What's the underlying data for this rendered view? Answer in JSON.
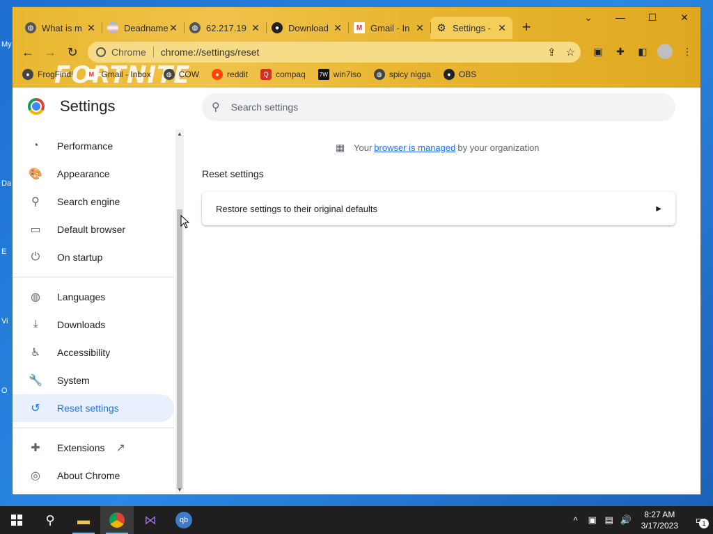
{
  "desktop": {
    "icon_labels": [
      "My",
      "Da",
      "E",
      "Vi",
      "O"
    ]
  },
  "tabs": [
    {
      "label": "What is m",
      "favicon": "globe-icon",
      "color": "#555555"
    },
    {
      "label": "Deadname",
      "favicon": "flag-icon",
      "color": "#c9a0dc"
    },
    {
      "label": "62.217.19",
      "favicon": "globe-icon",
      "color": "#555555"
    },
    {
      "label": "Download",
      "favicon": "obs-icon",
      "color": "#222222"
    },
    {
      "label": "Gmail - In",
      "favicon": "gmail-icon",
      "color": "#d93025"
    },
    {
      "label": "Settings -",
      "favicon": "gear-icon",
      "color": "#202124",
      "active": true
    }
  ],
  "omnibox": {
    "chip": "Chrome",
    "url": "chrome://settings/reset"
  },
  "bookmarks": [
    {
      "label": "FrogFind!",
      "color": "#444444"
    },
    {
      "label": "Gmail - Inbox",
      "color": "#d93025"
    },
    {
      "label": "COW",
      "color": "#444444"
    },
    {
      "label": "reddit",
      "color": "#ff4500"
    },
    {
      "label": "compaq",
      "color": "#d93025"
    },
    {
      "label": "win7iso",
      "color": "#111111"
    },
    {
      "label": "spicy nigga",
      "color": "#444444"
    },
    {
      "label": "OBS",
      "color": "#222222"
    }
  ],
  "background_text": "FORTNITE",
  "settings": {
    "title": "Settings",
    "search_placeholder": "Search settings",
    "managed_prefix": "Your",
    "managed_link": "browser is managed",
    "managed_suffix": "by your organization",
    "section_title": "Reset settings",
    "card_label": "Restore settings to their original defaults"
  },
  "nav": {
    "group1": [
      {
        "label": "Performance",
        "icon": "speedometer-icon"
      },
      {
        "label": "Appearance",
        "icon": "palette-icon"
      },
      {
        "label": "Search engine",
        "icon": "search-icon"
      },
      {
        "label": "Default browser",
        "icon": "browser-icon"
      },
      {
        "label": "On startup",
        "icon": "power-icon"
      }
    ],
    "group2": [
      {
        "label": "Languages",
        "icon": "globe-icon"
      },
      {
        "label": "Downloads",
        "icon": "download-icon"
      },
      {
        "label": "Accessibility",
        "icon": "accessibility-icon"
      },
      {
        "label": "System",
        "icon": "wrench-icon"
      },
      {
        "label": "Reset settings",
        "icon": "history-icon",
        "active": true
      }
    ],
    "group3": [
      {
        "label": "Extensions",
        "icon": "puzzle-icon"
      },
      {
        "label": "About Chrome",
        "icon": "chrome-icon"
      }
    ]
  },
  "taskbar": {
    "time": "8:27 AM",
    "date": "3/17/2023",
    "notification_count": "1"
  },
  "colors": {
    "accent": "#1a73e8",
    "titlebar": "#e8b830"
  }
}
